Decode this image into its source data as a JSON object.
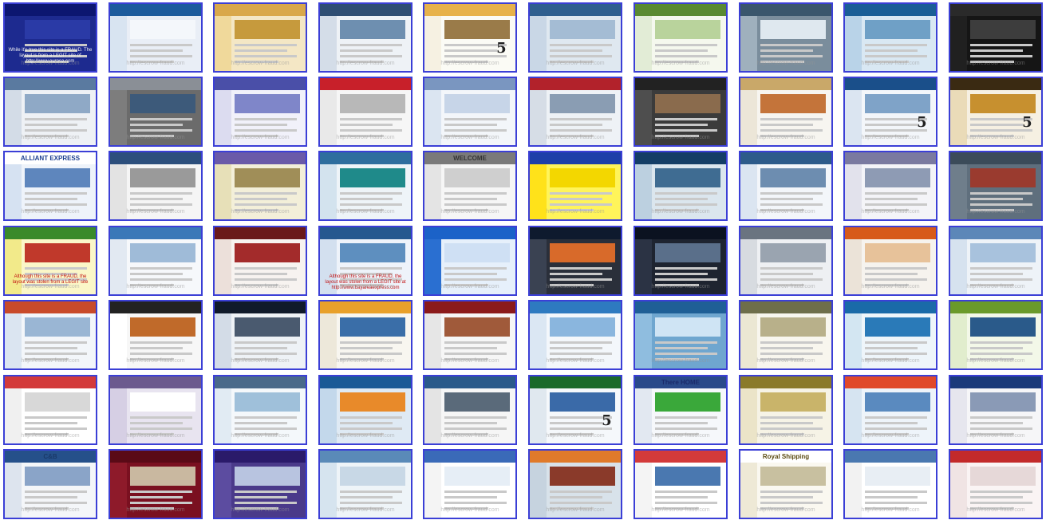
{
  "title": "",
  "watermark_text": "http://escrow-fraud.com",
  "colors": {
    "tile_border": "#3b3fd6",
    "background": "#ffffff"
  },
  "tiles": [
    {
      "theme": "#1d2a8f",
      "hdr": "#0c1670",
      "nav": "#1d2a8f",
      "hero": "#2a3aa6",
      "notice": "While it's true this site is a FRAUD. The layout is from a LEGIT site of http://www.eurosa.com",
      "noticeLight": true
    },
    {
      "theme": "#e9eef6",
      "hdr": "#1c5b9c",
      "nav": "#d8e4f1",
      "hero": "#f4f7fb"
    },
    {
      "theme": "#f4e7c5",
      "hdr": "#d9a84a",
      "nav": "#f0d99b",
      "hero": "#c69a3d"
    },
    {
      "theme": "#eef2f6",
      "hdr": "#2f4e73",
      "nav": "#d4dde8",
      "hero": "#6e8fb0"
    },
    {
      "theme": "#fbfbf5",
      "hdr": "#e7b24a",
      "nav": "#f6f1e2",
      "hero": "#9a7b49",
      "five": "5"
    },
    {
      "theme": "#dfe8f0",
      "hdr": "#2f5f8f",
      "nav": "#c9d7e6",
      "hero": "#a4bcd4"
    },
    {
      "theme": "#f5f8ee",
      "hdr": "#5a8a32",
      "nav": "#e2ecd6",
      "hero": "#b9d39c"
    },
    {
      "theme": "#7a8d9c",
      "hdr": "#3a566c",
      "nav": "#9fb0bd",
      "hero": "#dfe8ef"
    },
    {
      "theme": "#d9e8f3",
      "hdr": "#1a5e96",
      "nav": "#b9d3e8",
      "hero": "#6fa0c6"
    },
    {
      "theme": "#151515",
      "hdr": "#2a2a2a",
      "nav": "#202020",
      "hero": "#3d3d3d"
    },
    {
      "theme": "#eef1f5",
      "hdr": "#5a7aa0",
      "nav": "#d3dce7",
      "hero": "#8fa9c6"
    },
    {
      "theme": "#6b6b6b",
      "hdr": "#8a8f96",
      "nav": "#7d7d7d",
      "hero": "#3d5a7a"
    },
    {
      "theme": "#f1f1fa",
      "hdr": "#4a4fa8",
      "nav": "#dcdcf0",
      "hero": "#7f86c9"
    },
    {
      "theme": "#f6f6f6",
      "hdr": "#c8202a",
      "nav": "#e9e9e9",
      "hero": "#b8b8b8"
    },
    {
      "theme": "#f3f6fa",
      "hdr": "#7a96c0",
      "nav": "#dbe5f1",
      "hero": "#c7d5e8"
    },
    {
      "theme": "#eef2f6",
      "hdr": "#b2222b",
      "nav": "#d6dde6",
      "hero": "#8a9db3"
    },
    {
      "theme": "#3b3b3b",
      "hdr": "#222222",
      "nav": "#4e4e4e",
      "hero": "#8a6b4d"
    },
    {
      "theme": "#f7f5f0",
      "hdr": "#c9a869",
      "nav": "#ece6d8",
      "hero": "#c4743a"
    },
    {
      "theme": "#f3f6fa",
      "hdr": "#1a4f8a",
      "nav": "#dbe5f1",
      "hero": "#7fa3c8",
      "five": "5"
    },
    {
      "theme": "#f6f0e2",
      "hdr": "#3a2a12",
      "nav": "#eadbb8",
      "hero": "#c7902f",
      "five": "5"
    },
    {
      "theme": "#eef3fa",
      "hdr": "#ffffff",
      "nav": "#d6e2f2",
      "hero": "#5e86bd",
      "cap": "ALLIANT EXPRESS",
      "capColor": "#1b3f8f"
    },
    {
      "theme": "#f5f5f5",
      "hdr": "#2c4f7c",
      "nav": "#e3e3e3",
      "hero": "#9a9a9a"
    },
    {
      "theme": "#f3efd9",
      "hdr": "#6a5aa8",
      "nav": "#e7e0b8",
      "hero": "#a08e58"
    },
    {
      "theme": "#eef4f8",
      "hdr": "#2e6e9e",
      "nav": "#d3e3ee",
      "hero": "#1f8a8a"
    },
    {
      "theme": "#f6f6f6",
      "hdr": "#7a7a7a",
      "nav": "#e4e4e4",
      "hero": "#cfcfcf",
      "cap": "WELCOME",
      "capColor": "#333333"
    },
    {
      "theme": "#fff45a",
      "hdr": "#1d3fa8",
      "nav": "#ffe21a",
      "hero": "#f3d700"
    },
    {
      "theme": "#dbe6ee",
      "hdr": "#143e66",
      "nav": "#bcd0e0",
      "hero": "#3f6c92"
    },
    {
      "theme": "#f3f6fa",
      "hdr": "#2d5b8a",
      "nav": "#dbe5f1",
      "hero": "#6d8db0"
    },
    {
      "theme": "#f4f4f8",
      "hdr": "#7a7aa0",
      "nav": "#e2e2ec",
      "hero": "#8e9bb4"
    },
    {
      "theme": "#5f6f7d",
      "hdr": "#3b4b59",
      "nav": "#6f7e8b",
      "hero": "#9a3b2f"
    },
    {
      "theme": "#fbf7c8",
      "hdr": "#3a8a2a",
      "nav": "#f2ea8a",
      "hero": "#c0392b",
      "notice": "Although this site is a FRAUD, the layout was stolen from a LEGIT site"
    },
    {
      "theme": "#f6f8fb",
      "hdr": "#3a78b8",
      "nav": "#e2e9f2",
      "hero": "#9fbbd8"
    },
    {
      "theme": "#f7f3f0",
      "hdr": "#6a1a1a",
      "nav": "#ece0da",
      "hero": "#a32b2b"
    },
    {
      "theme": "#eef3fa",
      "hdr": "#25588f",
      "nav": "#d3e0ef",
      "hero": "#5e8fbf",
      "notice": "Although this site is a FRAUD, the layout was stolen from a LEGIT site at http://www.bayareaexpress.com"
    },
    {
      "theme": "#e6f0fb",
      "hdr": "#1b62c8",
      "nav": "#2a6fd1",
      "hero": "#cfe0f4"
    },
    {
      "theme": "#2a2f3a",
      "hdr": "#0e1a2e",
      "nav": "#3a4252",
      "hero": "#d86a2a"
    },
    {
      "theme": "#1e2430",
      "hdr": "#0b1220",
      "nav": "#2b3344",
      "hero": "#5a6f8a"
    },
    {
      "theme": "#eef0f3",
      "hdr": "#6a7480",
      "nav": "#d7dbe0",
      "hero": "#9aa4b0"
    },
    {
      "theme": "#f6f3ee",
      "hdr": "#d75a1a",
      "nav": "#ebe3d8",
      "hero": "#e7c29a"
    },
    {
      "theme": "#eef3f8",
      "hdr": "#5c87b8",
      "nav": "#d6e2ef",
      "hero": "#a8c2dd"
    },
    {
      "theme": "#f3f6fa",
      "hdr": "#c84a2a",
      "nav": "#dbe5f1",
      "hero": "#9ab6d4"
    },
    {
      "theme": "#f7f7f7",
      "hdr": "#222222",
      "nav": "#ffffff",
      "hero": "#c06a2a"
    },
    {
      "theme": "#eef2f6",
      "hdr": "#101a2a",
      "nav": "#d3dce7",
      "hero": "#4a5a6f"
    },
    {
      "theme": "#f8f6f0",
      "hdr": "#e8a02a",
      "nav": "#ede8da",
      "hero": "#3a6ea8"
    },
    {
      "theme": "#f6f6f6",
      "hdr": "#8b1a1a",
      "nav": "#e6e6e6",
      "hero": "#a05a3a"
    },
    {
      "theme": "#f3f7fb",
      "hdr": "#2e7ac0",
      "nav": "#dbe7f3",
      "hero": "#8ab6de"
    },
    {
      "theme": "#6fa6cf",
      "hdr": "#1f5f96",
      "nav": "#8fbddf",
      "hero": "#cfe4f4"
    },
    {
      "theme": "#f8f6ee",
      "hdr": "#6e6e4a",
      "nav": "#ebe7d3",
      "hero": "#b8b08a"
    },
    {
      "theme": "#eef5fa",
      "hdr": "#1a6aa8",
      "nav": "#d3e6f2",
      "hero": "#2a7ab8"
    },
    {
      "theme": "#f3f8e8",
      "hdr": "#6a9a2a",
      "nav": "#e1edcd",
      "hero": "#2a5a8a"
    },
    {
      "theme": "#ffffff",
      "hdr": "#d33a3a",
      "nav": "#f0f0f0",
      "hero": "#d8d8d8"
    },
    {
      "theme": "#e8e4f0",
      "hdr": "#6c5a8e",
      "nav": "#d6cfe4",
      "hero": "#ffffff"
    },
    {
      "theme": "#f4f8fb",
      "hdr": "#4a6a8a",
      "nav": "#e1ebf3",
      "hero": "#9fc0da"
    },
    {
      "theme": "#dfeaf4",
      "hdr": "#1a5a96",
      "nav": "#c3d8eb",
      "hero": "#e88a2a"
    },
    {
      "theme": "#f6f6f6",
      "hdr": "#2a5a8a",
      "nav": "#e4e4e4",
      "hero": "#5a6a7a"
    },
    {
      "theme": "#f5f8fb",
      "hdr": "#1a6a2a",
      "nav": "#e0e8ef",
      "hero": "#3a6aa8",
      "five": "5"
    },
    {
      "theme": "#f6f8fb",
      "hdr": "#2a4a8a",
      "nav": "#e2e8f1",
      "hero": "#3aa83a",
      "cap": "There HOME",
      "capColor": "#1a2a6a"
    },
    {
      "theme": "#f6f3e6",
      "hdr": "#8a7a2a",
      "nav": "#ebe4c8",
      "hero": "#c9b46a"
    },
    {
      "theme": "#eef4fa",
      "hdr": "#e0492a",
      "nav": "#d6e4f1",
      "hero": "#5a8abf"
    },
    {
      "theme": "#f6f6f8",
      "hdr": "#1a3a7a",
      "nav": "#e6e6ee",
      "hero": "#8a9ab6"
    },
    {
      "theme": "#f4f6f9",
      "hdr": "#25508a",
      "nav": "#dde4ee",
      "hero": "#8aa4c8",
      "cap": "C&B",
      "capColor": "#1a3a6a"
    },
    {
      "theme": "#7a1020",
      "hdr": "#5a0a16",
      "nav": "#8e1a2a",
      "hero": "#c9b8a0"
    },
    {
      "theme": "#4a3a8a",
      "hdr": "#2a1a6a",
      "nav": "#5c4ca0",
      "hero": "#b8c4e0"
    },
    {
      "theme": "#eef4f8",
      "hdr": "#5a8ab8",
      "nav": "#d6e4ef",
      "hero": "#c8d8e6"
    },
    {
      "theme": "#ffffff",
      "hdr": "#3a6ab8",
      "nav": "#f4f4f4",
      "hero": "#e6eef6"
    },
    {
      "theme": "#d8e2ea",
      "hdr": "#e07a2a",
      "nav": "#c6d3df",
      "hero": "#8a3a2a"
    },
    {
      "theme": "#ffffff",
      "hdr": "#d33a3a",
      "nav": "#f4f4f4",
      "hero": "#4a78b0"
    },
    {
      "theme": "#faf8f0",
      "hdr": "#ffffff",
      "nav": "#eee9d6",
      "hero": "#c8c0a0",
      "cap": "Royal Shipping",
      "capColor": "#5a4a10"
    },
    {
      "theme": "#ffffff",
      "hdr": "#4a78b0",
      "nav": "#f2f2f2",
      "hero": "#e8eef4"
    },
    {
      "theme": "#faf4f4",
      "hdr": "#c32a2a",
      "nav": "#f0e4e4",
      "hero": "#e6d8d8"
    }
  ]
}
